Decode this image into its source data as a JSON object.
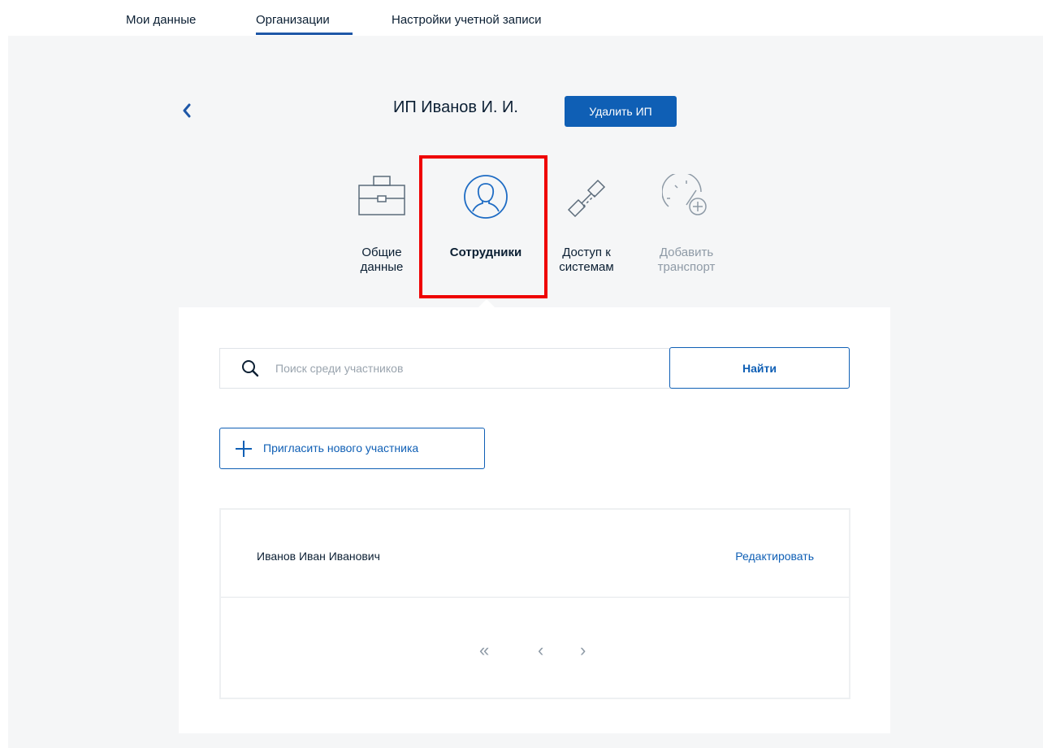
{
  "nav": {
    "tabs": [
      {
        "label": "Мои данные"
      },
      {
        "label": "Организации"
      },
      {
        "label": "Настройки учетной записи"
      }
    ],
    "active_tab": "Организации"
  },
  "org": {
    "title": "ИП Иванов И. И.",
    "delete_label": "Удалить ИП"
  },
  "sections": [
    {
      "label": "Общие данные",
      "icon": "briefcase-icon"
    },
    {
      "label": "Сотрудники",
      "icon": "person-icon"
    },
    {
      "label": "Доступ к системам",
      "icon": "link-icon"
    },
    {
      "label": "Добавить транспорт",
      "icon": "speedometer-plus-icon"
    }
  ],
  "search": {
    "placeholder": "Поиск среди участников",
    "button": "Найти"
  },
  "invite": {
    "label": "Пригласить нового участника"
  },
  "members": [
    {
      "name": "Иванов Иван Иванович",
      "action": "Редактировать"
    }
  ],
  "pager": {
    "first": "«",
    "prev": "‹",
    "next": "›"
  },
  "colors": {
    "accent": "#0f5fb5",
    "highlight": "#ee0000",
    "background": "#f5f6f7"
  }
}
